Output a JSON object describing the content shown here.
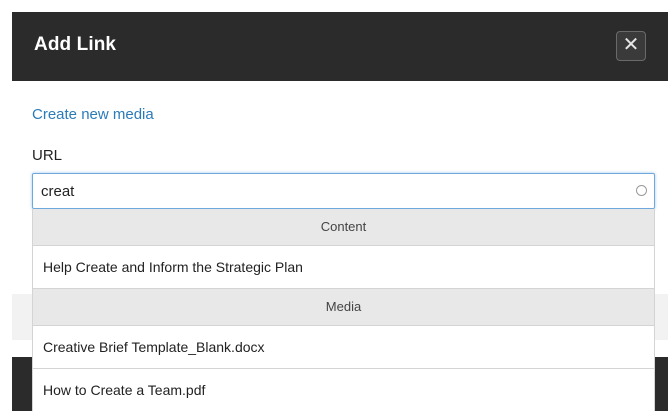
{
  "dialog": {
    "title": "Add Link",
    "close_symbol": "✕",
    "close_icon": "close-icon",
    "create_media_link": "Create new media",
    "url_label": "URL",
    "url_value": "creat",
    "loading_icon": "spinner-icon"
  },
  "suggestions": {
    "groups": [
      {
        "label": "Content",
        "items": [
          "Help Create and Inform the Strategic Plan"
        ]
      },
      {
        "label": "Media",
        "items": [
          "Creative Brief Template_Blank.docx",
          "How to Create a Team.pdf"
        ]
      }
    ]
  },
  "colors": {
    "header_bg": "#2b2b2b",
    "link": "#2b7bb9",
    "input_focus_border": "#6fa8dc",
    "group_header_bg": "#e8e8e8"
  }
}
